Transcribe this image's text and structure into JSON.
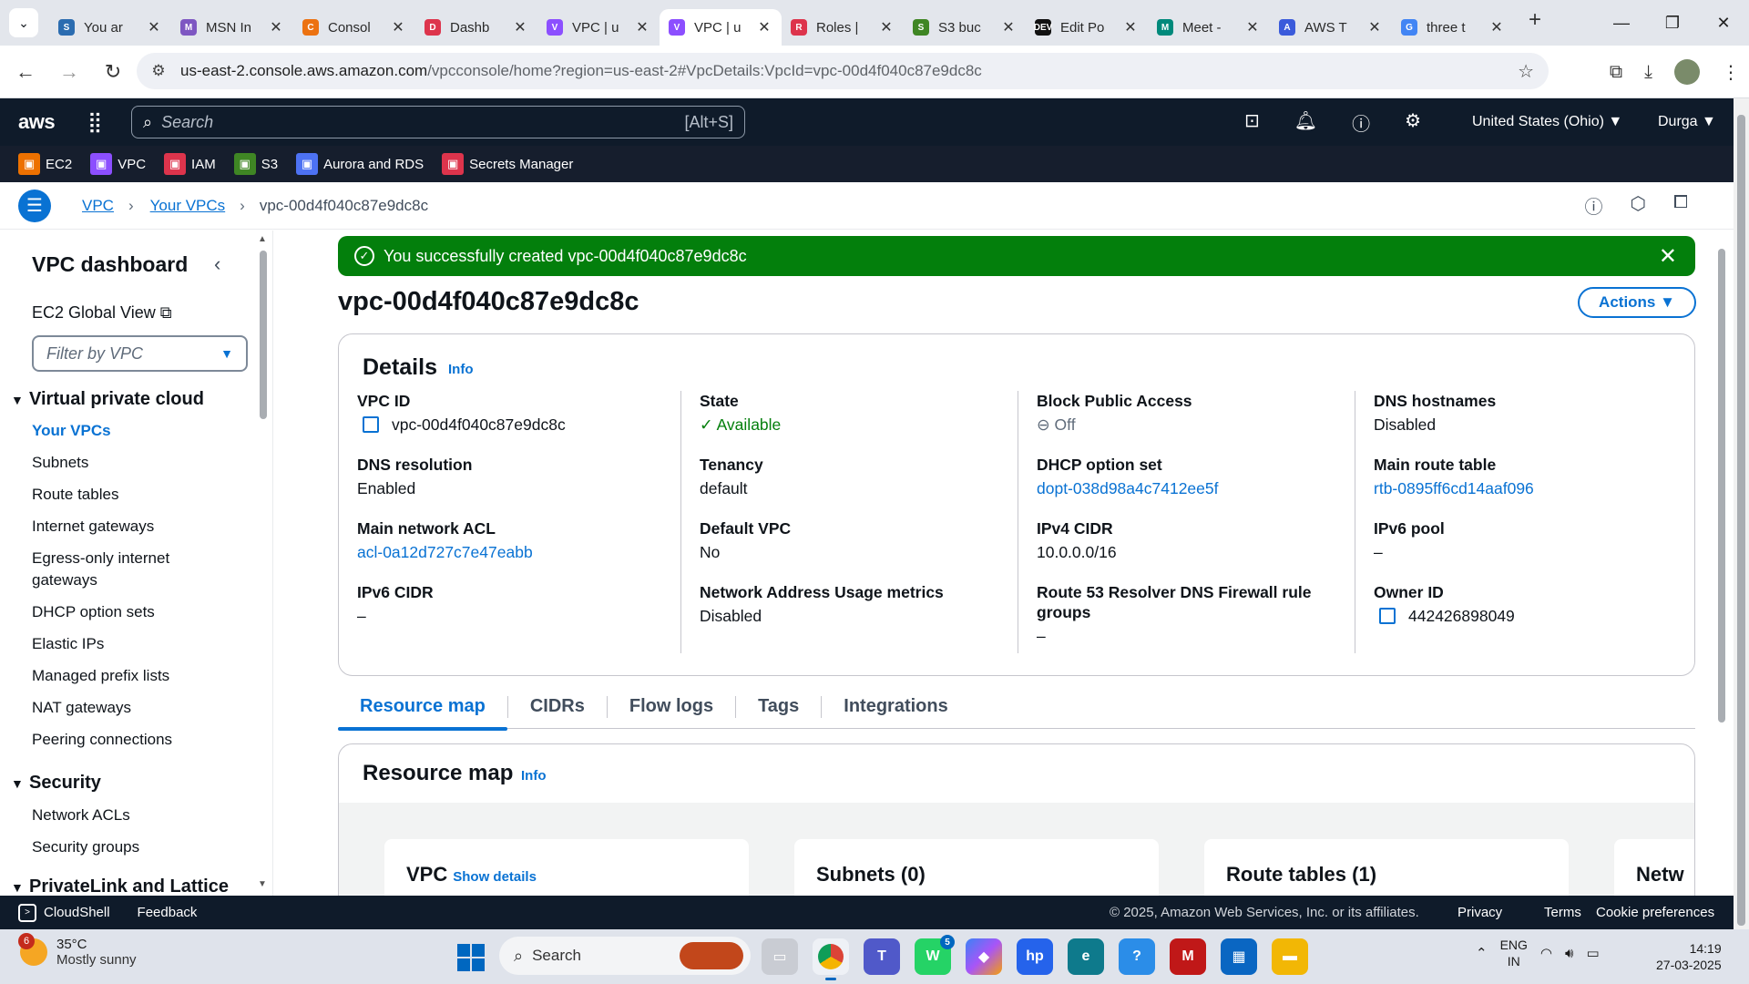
{
  "browser": {
    "tabs": [
      {
        "title": "You ar",
        "icon": "S",
        "color": "#2b6cb0"
      },
      {
        "title": "MSN In",
        "icon": "M",
        "color": "#7e57c2"
      },
      {
        "title": "Consol",
        "icon": "C",
        "color": "#ec7211"
      },
      {
        "title": "Dashb",
        "icon": "D",
        "color": "#dd344c"
      },
      {
        "title": "VPC | u",
        "icon": "V",
        "color": "#8c4fff"
      },
      {
        "title": "VPC | u",
        "icon": "V",
        "color": "#8c4fff"
      },
      {
        "title": "Roles |",
        "icon": "R",
        "color": "#dd344c"
      },
      {
        "title": "S3 buc",
        "icon": "S",
        "color": "#3f8624"
      },
      {
        "title": "Edit Po",
        "icon": "DEV",
        "color": "#111111"
      },
      {
        "title": "Meet -",
        "icon": "M",
        "color": "#00897b"
      },
      {
        "title": "AWS T",
        "icon": "A",
        "color": "#3b5bdb"
      },
      {
        "title": "three t",
        "icon": "G",
        "color": "#4285f4"
      }
    ],
    "active_tab_index": 5,
    "url_host": "us-east-2.console.aws.amazon.com",
    "url_rest": "/vpcconsole/home?region=us-east-2#VpcDetails:VpcId=vpc-00d4f040c87e9dc8c"
  },
  "aws_nav": {
    "logo": "aws",
    "search_placeholder": "Search",
    "search_shortcut": "[Alt+S]",
    "region": "United States (Ohio) ▼",
    "user": "Durga ▼"
  },
  "favorites": [
    {
      "label": "EC2",
      "color": "#ed7100"
    },
    {
      "label": "VPC",
      "color": "#8c4fff"
    },
    {
      "label": "IAM",
      "color": "#dd344c"
    },
    {
      "label": "S3",
      "color": "#3f8624"
    },
    {
      "label": "Aurora and RDS",
      "color": "#4d72f3"
    },
    {
      "label": "Secrets Manager",
      "color": "#dd344c"
    }
  ],
  "breadcrumb": {
    "items": [
      "VPC",
      "Your VPCs"
    ],
    "current": "vpc-00d4f040c87e9dc8c"
  },
  "sidenav": {
    "title": "VPC dashboard",
    "ec2_global": "EC2 Global View",
    "filter_placeholder": "Filter by VPC",
    "section_vpc": "Virtual private cloud",
    "vpc_items": [
      "Your VPCs",
      "Subnets",
      "Route tables",
      "Internet gateways",
      "Egress-only internet",
      "gateways",
      "DHCP option sets",
      "Elastic IPs",
      "Managed prefix lists",
      "NAT gateways",
      "Peering connections"
    ],
    "section_security": "Security",
    "security_items": [
      "Network ACLs",
      "Security groups"
    ],
    "section_privatelink": "PrivateLink and Lattice"
  },
  "flash": {
    "message": "You successfully created vpc-00d4f040c87e9dc8c"
  },
  "page": {
    "title": "vpc-00d4f040c87e9dc8c",
    "actions": "Actions ▼"
  },
  "details": {
    "heading": "Details",
    "info": "Info",
    "vpc_id_label": "VPC ID",
    "vpc_id": "vpc-00d4f040c87e9dc8c",
    "state_label": "State",
    "state": "Available",
    "bpa_label": "Block Public Access",
    "bpa": "Off",
    "dns_hostnames_label": "DNS hostnames",
    "dns_hostnames": "Disabled",
    "dns_resolution_label": "DNS resolution",
    "dns_resolution": "Enabled",
    "tenancy_label": "Tenancy",
    "tenancy": "default",
    "dhcp_label": "DHCP option set",
    "dhcp": "dopt-038d98a4c7412ee5f",
    "main_route_label": "Main route table",
    "main_route": "rtb-0895ff6cd14aaf096",
    "main_acl_label": "Main network ACL",
    "main_acl": "acl-0a12d727c7e47eabb",
    "default_vpc_label": "Default VPC",
    "default_vpc": "No",
    "ipv4_label": "IPv4 CIDR",
    "ipv4": "10.0.0.0/16",
    "ipv6_pool_label": "IPv6 pool",
    "ipv6_pool": "–",
    "ipv6_cidr_label": "IPv6 CIDR",
    "ipv6_cidr": "–",
    "nau_label": "Network Address Usage metrics",
    "nau": "Disabled",
    "r53_label_1": "Route 53 Resolver DNS Firewall rule",
    "r53_label_2": "groups",
    "r53": "–",
    "owner_label": "Owner ID",
    "owner": "442426898049"
  },
  "content_tabs": [
    "Resource map",
    "CIDRs",
    "Flow logs",
    "Tags",
    "Integrations"
  ],
  "resource_map": {
    "heading": "Resource map",
    "info": "Info",
    "cards": [
      {
        "title": "VPC",
        "extra": "Show details"
      },
      {
        "title": "Subnets (0)",
        "extra": ""
      },
      {
        "title": "Route tables (1)",
        "extra": ""
      },
      {
        "title": "Netw",
        "extra": ""
      }
    ]
  },
  "footer": {
    "cloudshell": "CloudShell",
    "feedback": "Feedback",
    "copyright": "© 2025, Amazon Web Services, Inc. or its affiliates.",
    "privacy": "Privacy",
    "terms": "Terms",
    "cookies": "Cookie preferences"
  },
  "taskbar": {
    "weather_badge": "6",
    "temp": "35°C",
    "condition": "Mostly sunny",
    "search": "Search",
    "lang1": "ENG",
    "lang2": "IN",
    "time": "14:19",
    "date": "27-03-2025",
    "whatsapp_badge": "5"
  }
}
